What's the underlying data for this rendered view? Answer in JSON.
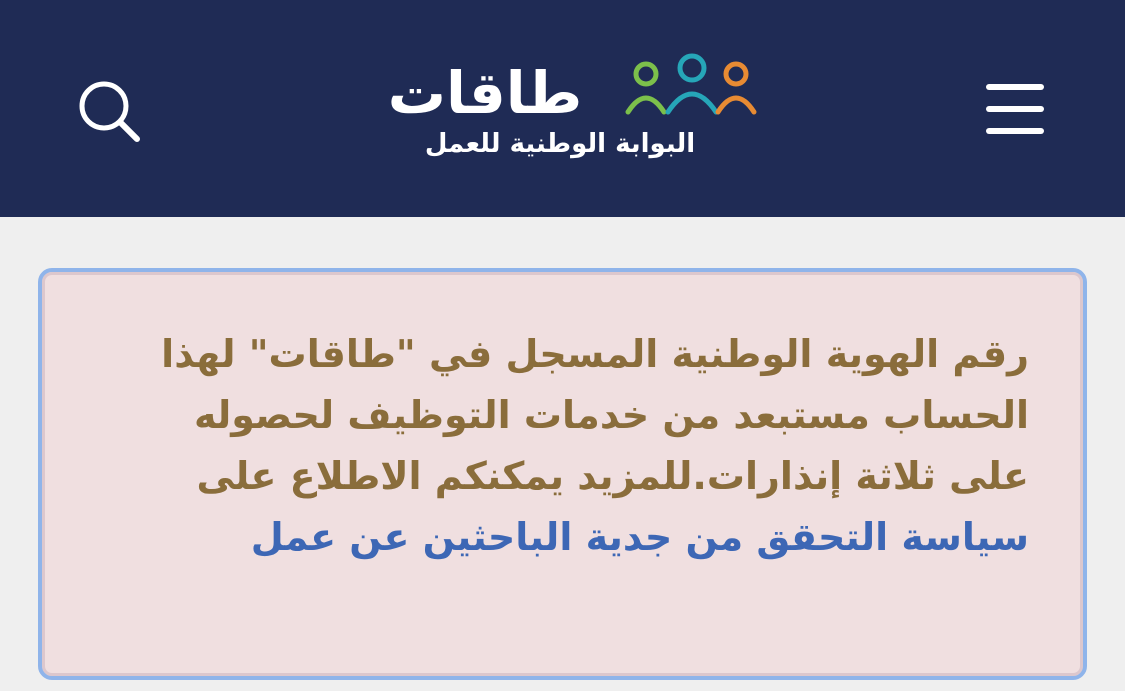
{
  "header": {
    "logo_word": "طاقات",
    "logo_tagline": "البوابة الوطنية للعمل",
    "search_icon": "search-icon",
    "menu_icon": "hamburger-menu-icon"
  },
  "alert": {
    "message": "رقم الهوية الوطنية المسجل في \"طاقات\" لهذا الحساب مستبعد من خدمات التوظيف لحصوله على ثلاثة إنذارات.للمزيد يمكنكم الاطلاع على ",
    "link_text": "سياسة التحقق من جدية الباحثين عن عمل"
  },
  "colors": {
    "header_bg": "#1f2b55",
    "page_bg": "#efefef",
    "alert_bg": "#f0dfe0",
    "alert_border": "#8fb4ea",
    "alert_text": "#8a6d3b",
    "link": "#3d67b5"
  }
}
